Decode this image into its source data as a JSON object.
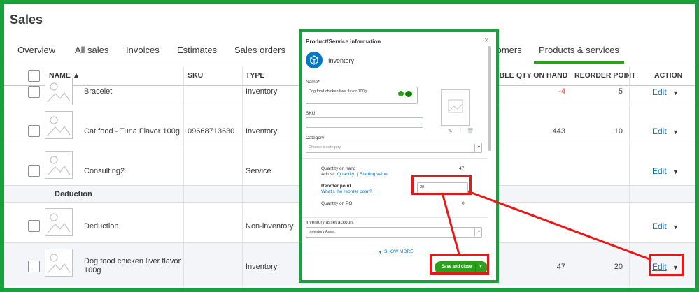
{
  "page": {
    "title": "Sales"
  },
  "tabs": [
    {
      "label": "Overview"
    },
    {
      "label": "All sales"
    },
    {
      "label": "Invoices"
    },
    {
      "label": "Estimates"
    },
    {
      "label": "Sales orders"
    },
    {
      "label": "tomers"
    },
    {
      "label": "Products & services"
    }
  ],
  "table": {
    "headers": {
      "name": "NAME ▲",
      "sku": "SKU",
      "type": "TYPE",
      "able": "ABLE",
      "qty_on_hand": "QTY ON HAND",
      "reorder_point": "REORDER POINT",
      "action": "ACTION"
    },
    "rows": [
      {
        "name": "Bracelet",
        "sku": "",
        "type": "Inventory",
        "qty": "-4",
        "reorder": "5",
        "action": "Edit"
      },
      {
        "name": "Cat food - Tuna Flavor 100g",
        "sku": "09668713630",
        "type": "Inventory",
        "qty": "443",
        "reorder": "10",
        "action": "Edit"
      },
      {
        "name": "Consulting2",
        "sku": "",
        "type": "Service",
        "qty": "",
        "reorder": "",
        "action": "Edit"
      },
      {
        "name": "Deduction",
        "sku": "",
        "type": "Non-inventory",
        "qty": "",
        "reorder": "",
        "action": "Edit"
      },
      {
        "name": "Dog food chicken liver flavor 100g",
        "sku": "",
        "type": "Inventory",
        "qty": "47",
        "reorder": "20",
        "action": "Edit"
      }
    ],
    "group_label": "Deduction"
  },
  "modal": {
    "title": "Product/Service information",
    "type_label": "Inventory",
    "name_label": "Name*",
    "name_value": "Dog food chicken liver flavor 100g",
    "sku_label": "SKU",
    "sku_value": "",
    "category_label": "Category",
    "category_placeholder": "Choose a category",
    "qty_on_hand_label": "Quantity on hand",
    "qty_on_hand_value": "47",
    "adjust_prefix": "Adjust:",
    "adjust_quantity_link": "Quantity",
    "adjust_separator": "|",
    "adjust_starting_link": "Starting value",
    "reorder_label": "Reorder point",
    "reorder_help_link": "What's the reorder point?",
    "reorder_value": "20",
    "qty_on_po_label": "Quantity on PO",
    "qty_on_po_value": "0",
    "asset_account_label": "Inventory asset account",
    "asset_account_value": "Inventory Asset",
    "show_more": "SHOW MORE",
    "save_label": "Save and close",
    "close_glyph": "×"
  },
  "colors": {
    "brand_green": "#2ca01c",
    "annotation_red": "#e81818",
    "frame_green": "#17a33b",
    "link_blue": "#0077c5"
  }
}
